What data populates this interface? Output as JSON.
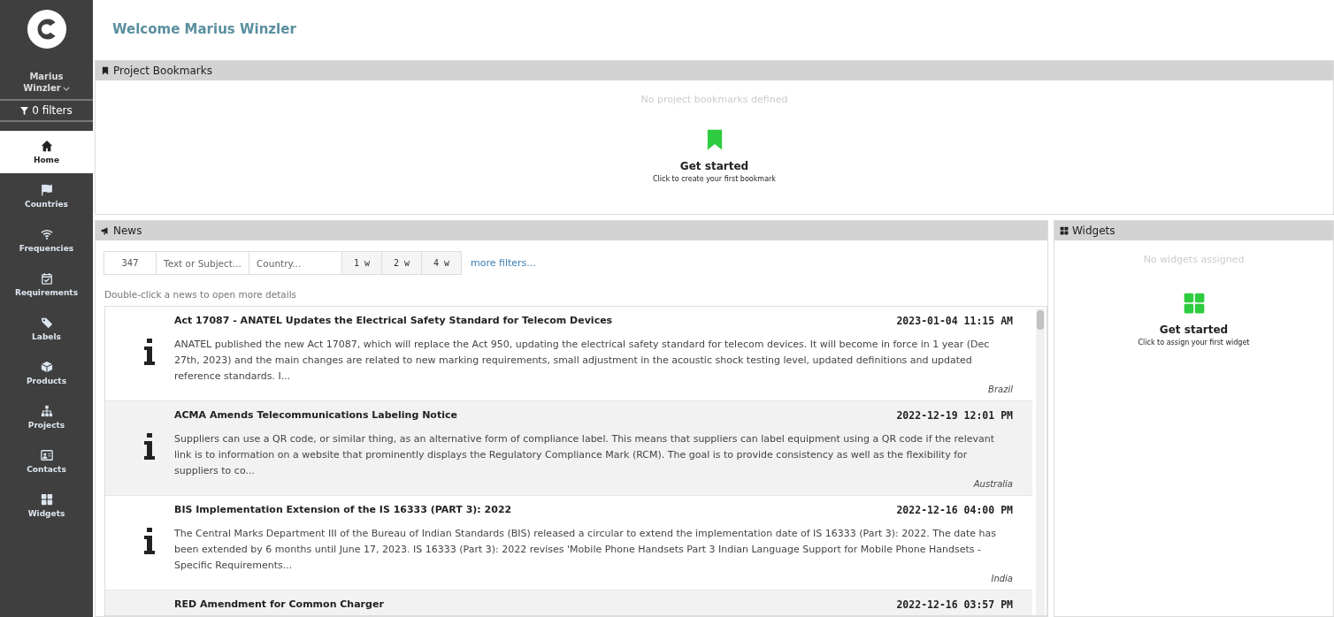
{
  "sidebar": {
    "user_name": "Marius Winzler",
    "filters": "0 filters",
    "items": [
      {
        "label": "Home",
        "selected": true
      },
      {
        "label": "Countries",
        "selected": false
      },
      {
        "label": "Frequencies",
        "selected": false
      },
      {
        "label": "Requirements",
        "selected": false
      },
      {
        "label": "Labels",
        "selected": false
      },
      {
        "label": "Products",
        "selected": false
      },
      {
        "label": "Projects",
        "selected": false
      },
      {
        "label": "Contacts",
        "selected": false
      },
      {
        "label": "Widgets",
        "selected": false
      }
    ]
  },
  "page_title": "Welcome Marius Winzler",
  "bookmarks": {
    "title": "Project Bookmarks",
    "empty_text": "No project bookmarks defined",
    "cta_title": "Get started",
    "cta_subtitle": "Click to create your first bookmark"
  },
  "news": {
    "title": "News",
    "count": "347",
    "text_placeholder": "Text or Subject...",
    "country_placeholder": "Country...",
    "ranges": [
      "1 w",
      "2 w",
      "4 w"
    ],
    "more_filters": "more filters...",
    "hint": "Double-click a news to open more details",
    "items": [
      {
        "title": "Act 17087 - ANATEL Updates the Electrical Safety Standard for Telecom Devices",
        "date": "2023-01-04 11:15 AM",
        "body": "ANATEL published the new Act 17087, which will replace the Act 950, updating the electrical safety standard for telecom devices. It will become in force in 1 year (Dec 27th, 2023) and the main changes are related to new marking requirements, small adjustment in the acoustic shock testing level, updated definitions and updated reference standards. I...",
        "country": "Brazil"
      },
      {
        "title": "ACMA Amends Telecommunications Labeling Notice",
        "date": "2022-12-19 12:01 PM",
        "body": "Suppliers can use a QR code, or similar thing, as an alternative form of compliance label. This means that suppliers can label equipment using a QR code if the relevant link is to information on a website that prominently displays the Regulatory Compliance Mark (RCM). The goal is to provide consistency as well as the flexibility for suppliers to co...",
        "country": "Australia"
      },
      {
        "title": "BIS Implementation Extension of the IS 16333 (PART 3): 2022",
        "date": "2022-12-16 04:00 PM",
        "body": "The Central Marks Department III of the Bureau of Indian Standards (BIS) released a circular to extend the implementation date of IS 16333 (Part 3): 2022. The date has been extended by 6 months until June 17, 2023. IS 16333 (Part 3): 2022 revises 'Mobile Phone Handsets Part 3 Indian Language Support for Mobile Phone Handsets - Specific Requirements...",
        "country": "India"
      },
      {
        "title": "RED Amendment for Common Charger",
        "date": "2022-12-16 03:57 PM"
      }
    ]
  },
  "widgets": {
    "title": "Widgets",
    "empty_text": "No widgets assigned",
    "cta_title": "Get started",
    "cta_subtitle": "Click to assign your first widget"
  }
}
